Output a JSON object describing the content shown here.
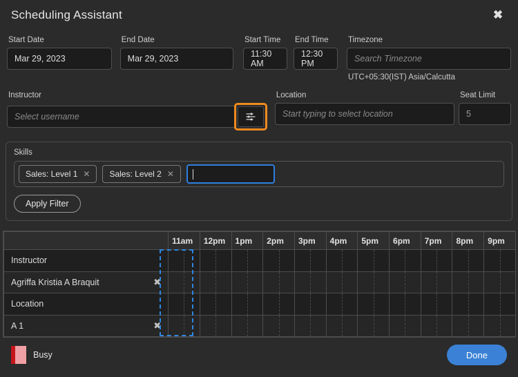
{
  "header": {
    "title": "Scheduling Assistant",
    "close_icon": "close-icon"
  },
  "form": {
    "start_date": {
      "label": "Start Date",
      "value": "Mar 29, 2023"
    },
    "end_date": {
      "label": "End Date",
      "value": "Mar 29, 2023"
    },
    "start_time": {
      "label": "Start Time",
      "value": "11:30 AM"
    },
    "end_time": {
      "label": "End Time",
      "value": "12:30 PM"
    },
    "timezone": {
      "label": "Timezone",
      "placeholder": "Search Timezone",
      "value": "",
      "note": "UTC+05:30(IST) Asia/Calcutta"
    },
    "instructor": {
      "label": "Instructor",
      "placeholder": "Select username",
      "value": "",
      "filter_icon": "sliders-icon"
    },
    "location": {
      "label": "Location",
      "placeholder": "Start typing to select location",
      "value": ""
    },
    "seat_limit": {
      "label": "Seat Limit",
      "value": "5"
    }
  },
  "skills": {
    "label": "Skills",
    "chips": [
      {
        "label": "Sales: Level 1",
        "remove_icon": "close-icon"
      },
      {
        "label": "Sales: Level 2",
        "remove_icon": "close-icon"
      }
    ],
    "input_value": "",
    "apply_label": "Apply Filter"
  },
  "schedule": {
    "hours": [
      "11am",
      "12pm",
      "1pm",
      "2pm",
      "3pm",
      "4pm",
      "5pm",
      "6pm",
      "7pm",
      "8pm",
      "9pm"
    ],
    "rows": [
      {
        "label": "Instructor",
        "removable": false,
        "type": "group"
      },
      {
        "label": "Agriffa Kristia A Braquit",
        "removable": true,
        "remove_icon": "remove-circle-icon",
        "type": "resource"
      },
      {
        "label": "Location",
        "removable": false,
        "type": "group"
      },
      {
        "label": "A 1",
        "removable": true,
        "remove_icon": "remove-circle-icon",
        "type": "resource"
      }
    ],
    "selection": {
      "start": "11:30 AM",
      "end": "12:30 PM",
      "color": "#2f86e0"
    }
  },
  "footer": {
    "legend_label": "Busy",
    "legend_color": "#f0a0a5",
    "legend_accent": "#c4161c",
    "done_label": "Done",
    "done_color": "#3b82d6"
  }
}
